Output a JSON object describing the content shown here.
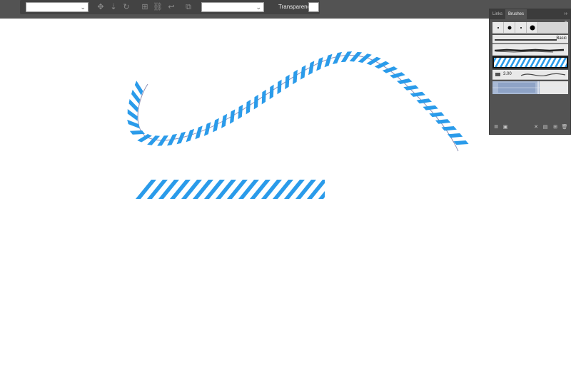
{
  "toolbar": {
    "style_dropdown_value": "",
    "blend_dropdown_value": "",
    "transparency_label": "Transparency",
    "icons": [
      "move-icon",
      "anchor-icon",
      "rotate-icon",
      "isolate-icon",
      "link-icon",
      "return-icon",
      "symbol-icon"
    ]
  },
  "panel": {
    "tabs": [
      "Links",
      "Brushes"
    ],
    "active_tab": "Brushes",
    "basic_label": "Basic",
    "stroke_size": "3.00",
    "dot_brushes": [
      "tiny-dot",
      "medium-dot",
      "small-dot",
      "large-dot"
    ],
    "footer_icons": [
      "brush-libraries-icon",
      "libraries-panel-icon",
      "remove-stroke-icon",
      "brush-options-icon",
      "new-brush-icon",
      "delete-brush-icon"
    ]
  },
  "canvas": {
    "stroke_color": "#2a9bea",
    "path_color": "#8e8fb4"
  },
  "colors": {
    "toolbar_bg": "#535353",
    "panel_bg": "#535353",
    "accent": "#2a9bea"
  }
}
